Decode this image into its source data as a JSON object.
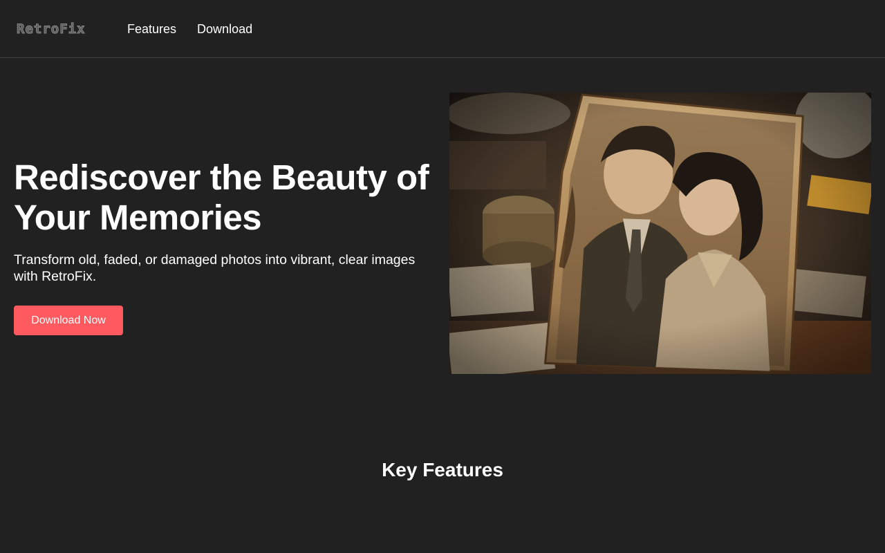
{
  "header": {
    "logo_text": "RetroFix",
    "nav": [
      {
        "label": "Features"
      },
      {
        "label": "Download"
      }
    ]
  },
  "hero": {
    "title": "Rediscover the Beauty of Your Memories",
    "subtitle": "Transform old, faded, or damaged photos into vibrant, clear images with RetroFix.",
    "cta_label": "Download Now",
    "image_subject": "vintage sepia photograph of a couple on a cluttered antique table"
  },
  "features": {
    "title": "Key Features"
  },
  "colors": {
    "background": "#212121",
    "accent": "#ff5a5f",
    "text": "#ffffff",
    "divider": "#3d3d3d"
  }
}
